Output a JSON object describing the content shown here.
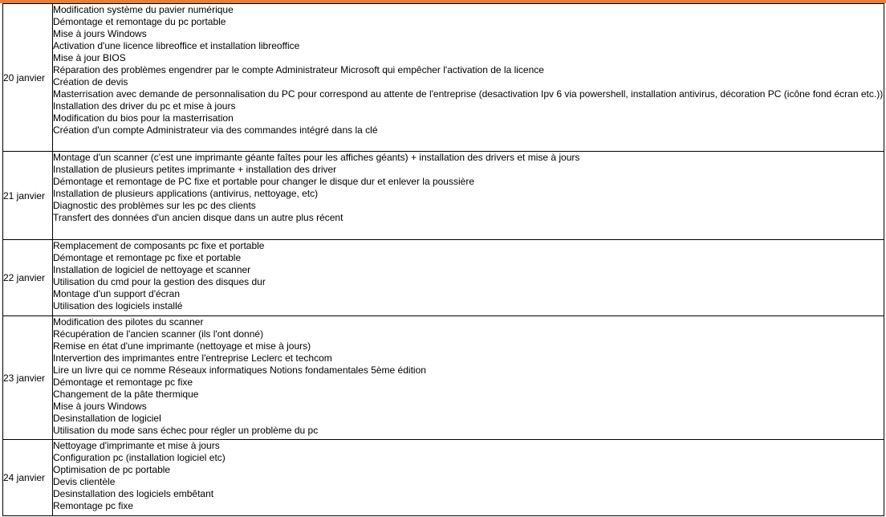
{
  "rows": [
    {
      "date": "20 janvier",
      "tasks": [
        "Modification système du pavier numérique",
        "Démontage et remontage du pc portable",
        "Mise à jours Windows",
        "Activation d'une licence libreoffice et installation libreoffice",
        "Mise à jour BIOS",
        "Réparation des problèmes engendrer par le compte Administrateur Microsoft qui empêcher l'activation de la licence",
        "Création de devis",
        "Masterrisation avec demande de personnalisation du PC pour correspond au attente de l'entreprise (desactivation Ipv 6 via powershell, installation antivirus,  décoration PC (icône fond écran etc.))",
        "Installation des driver du pc et mise à jours",
        "Modification du bios pour la masterrisation",
        "Création d'un compte Administrateur via des commandes intégré dans la clé"
      ]
    },
    {
      "date": "21 janvier",
      "tasks": [
        "Montage d'un scanner (c'est une imprimante géante faîtes pour les affiches géants) + installation des drivers et mise à jours",
        "Installation de plusieurs petites imprimante + installation des driver",
        "Démontage et remontage de PC fixe et portable pour changer le disque dur et enlever la poussière",
        "Installation de plusieurs applications (antivirus, nettoyage, etc)",
        "Diagnostic des problèmes sur les pc des clients",
        "Transfert des données d'un ancien disque dans un autre plus récent"
      ]
    },
    {
      "date": "22 janvier",
      "tasks": [
        "Remplacement de composants pc fixe et portable",
        "Démontage et remontage pc fixe et portable",
        "Installation de logiciel de nettoyage et scanner",
        "Utilisation du cmd pour la gestion des disques dur",
        "Montage d'un support d'écran",
        "Utilisation des logiciels installé"
      ]
    },
    {
      "date": "23 janvier",
      "tasks": [
        "Modification des pilotes du scanner",
        "Récupération de l'ancien scanner (ils l'ont donné)",
        "Remise en état d'une imprimante (nettoyage et mise à jours)",
        "Intervertion des imprimantes entre l'entreprise Leclerc et techcom",
        "Lire un livre qui ce nomme Réseaux informatiques Notions fondamentales 5ème édition",
        "Démontage et remontage pc fixe",
        "Changement de la pâte thermique",
        "Mise à jours Windows",
        "Desinstallation de logiciel",
        "Utilisation du mode sans échec pour régler un problème du pc"
      ]
    },
    {
      "date": "24 janvier",
      "tasks": [
        "Nettoyage d'imprimante et mise à jours",
        "Configuration pc (installation logiciel etc)",
        "Optimisation de pc portable",
        "Devis clientèle",
        "Desinstallation des logiciels embêtant",
        "Remontage pc fixe"
      ]
    }
  ]
}
